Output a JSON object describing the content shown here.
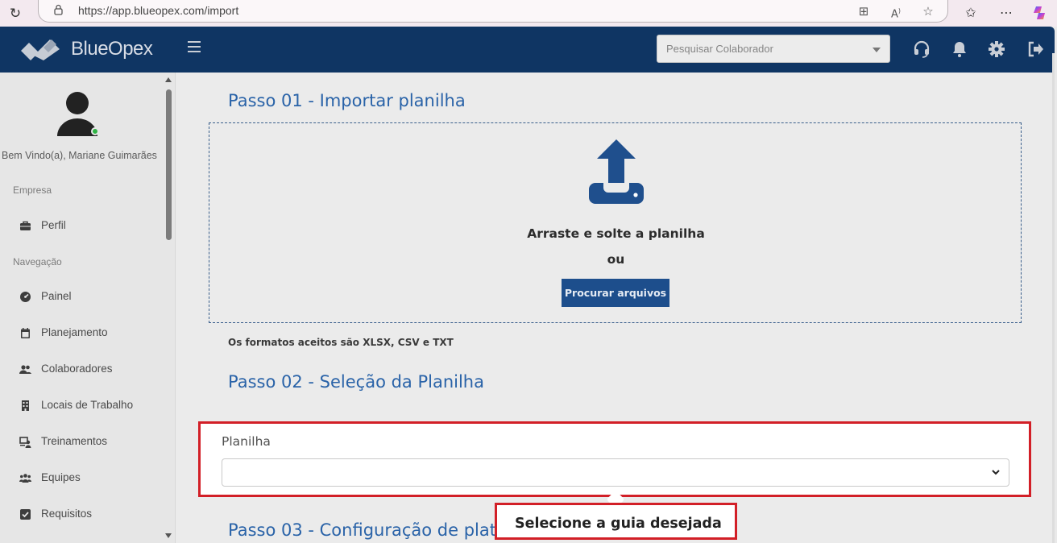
{
  "browser": {
    "url": "https://app.blueopex.com/import"
  },
  "header": {
    "logo_text": "BlueOpex",
    "search_placeholder": "Pesquisar Colaborador",
    "brand_color": "#0f3563"
  },
  "sidebar": {
    "welcome": "Bem Vindo(a), Mariane Guimarães",
    "section_company": "Empresa",
    "section_nav": "Navegação",
    "items": [
      {
        "label": "Perfil",
        "icon": "briefcase-icon"
      },
      {
        "label": "Painel",
        "icon": "dashboard-icon"
      },
      {
        "label": "Planejamento",
        "icon": "calendar-icon"
      },
      {
        "label": "Colaboradores",
        "icon": "users-icon"
      },
      {
        "label": "Locais de Trabalho",
        "icon": "building-icon"
      },
      {
        "label": "Treinamentos",
        "icon": "training-icon"
      },
      {
        "label": "Equipes",
        "icon": "team-icon"
      },
      {
        "label": "Requisitos",
        "icon": "checkbox-icon"
      }
    ]
  },
  "main": {
    "step1_title": "Passo 01 - Importar planilha",
    "dropzone_text": "Arraste e solte a planilha",
    "dropzone_or": "ou",
    "browse_button": "Procurar arquivos",
    "formats_note": "Os formatos aceitos são XLSX, CSV e TXT",
    "step2_title": "Passo 02 - Seleção da Planilha",
    "sheet_label": "Planilha",
    "sheet_value": "",
    "step3_title": "Passo 03 - Configuração de plata"
  },
  "tooltip": {
    "text": "Selecione a guia desejada",
    "highlight_color": "#d21f27"
  }
}
